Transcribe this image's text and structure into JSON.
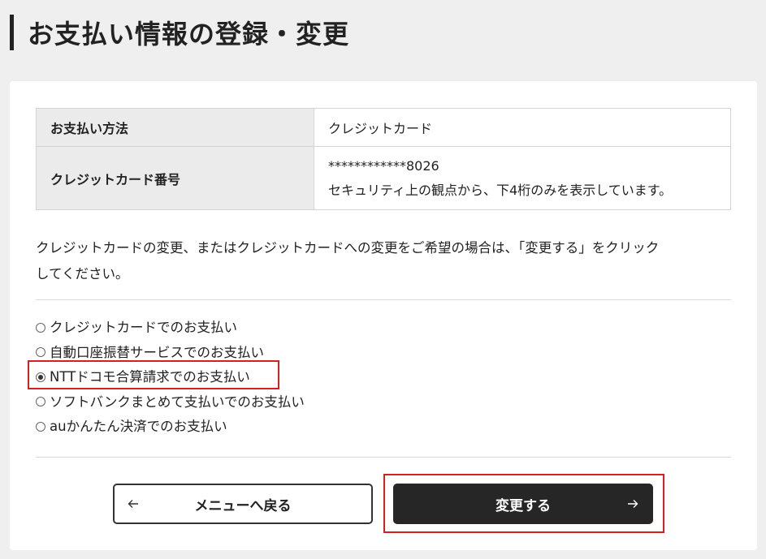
{
  "page": {
    "title": "お支払い情報の登録・変更"
  },
  "payment_info": {
    "method_label": "お支払い方法",
    "method_value": "クレジットカード",
    "card_label": "クレジットカード番号",
    "card_number": "************8026",
    "card_note": "セキュリティ上の観点から、下4桁のみを表示しています。"
  },
  "description": {
    "line1": "クレジットカードの変更、またはクレジットカードへの変更をご希望の場合は、「変更する」をクリック",
    "line2": "してください。"
  },
  "payment_options": [
    {
      "label": "クレジットカードでのお支払い",
      "selected": false
    },
    {
      "label": "自動口座振替サービスでのお支払い",
      "selected": false
    },
    {
      "label": "NTTドコモ合算請求でのお支払い",
      "selected": true
    },
    {
      "label": "ソフトバンクまとめて支払いでのお支払い",
      "selected": false
    },
    {
      "label": "auかんたん決済でのお支払い",
      "selected": false
    }
  ],
  "buttons": {
    "back_label": "メニューへ戻る",
    "submit_label": "変更する"
  },
  "colors": {
    "highlight": "#d32020",
    "submit_bg": "#262626",
    "page_bg": "#efefef"
  }
}
